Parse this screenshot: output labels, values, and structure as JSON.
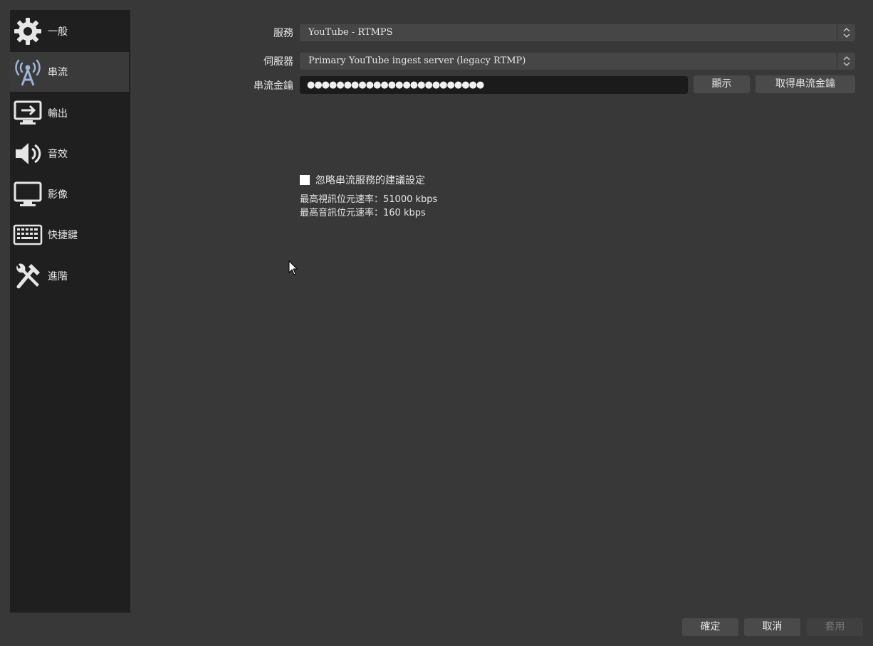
{
  "sidebar": {
    "items": [
      {
        "label": "一般",
        "icon": "gear-icon"
      },
      {
        "label": "串流",
        "icon": "broadcast-antenna-icon"
      },
      {
        "label": "輸出",
        "icon": "output-monitor-icon"
      },
      {
        "label": "音效",
        "icon": "speaker-icon"
      },
      {
        "label": "影像",
        "icon": "display-icon"
      },
      {
        "label": "快捷鍵",
        "icon": "keyboard-icon"
      },
      {
        "label": "進階",
        "icon": "tools-icon"
      }
    ],
    "active": "串流"
  },
  "stream": {
    "service_label": "服務",
    "service_value": "YouTube - RTMPS",
    "server_label": "伺服器",
    "server_value": "Primary YouTube ingest server (legacy RTMP)",
    "key_label": "串流金鑰",
    "key_masked": "●●●●●●●●●●●●●●●●●●●●●●●●",
    "show_button": "顯示",
    "get_key_button": "取得串流金鑰",
    "ignore_checkbox_label": "忽略串流服務的建議設定",
    "ignore_checked": false,
    "max_video_bitrate": "最高視訊位元速率：51000 kbps",
    "max_audio_bitrate": "最高音訊位元速率：160 kbps"
  },
  "footer": {
    "ok_button": "確定",
    "cancel_button": "取消",
    "apply_button": "套用"
  },
  "colors": {
    "background": "#383838",
    "sidebar": "#1f1f1f",
    "active_item": "#3a3a3a",
    "icon_accent": "#9db4d6"
  }
}
